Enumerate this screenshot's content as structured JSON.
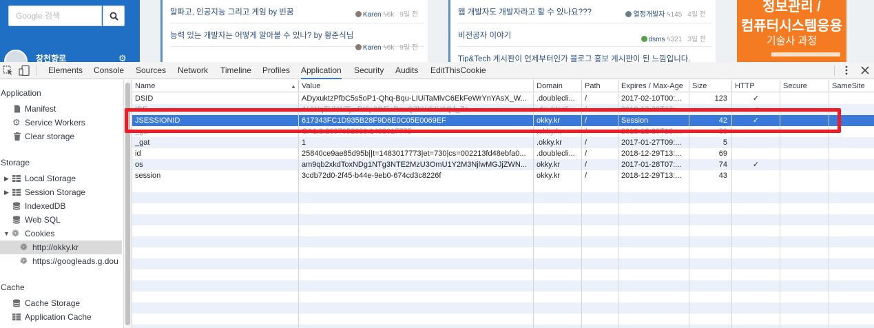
{
  "page": {
    "search": {
      "placeholder": "Google 검색"
    },
    "nav_user": "창천향로",
    "posts_left": [
      {
        "title": "알파고, 인공지능 그리고 게임 by 빈꿈",
        "author": "Karen",
        "score": "6k",
        "ago": "9일 전"
      },
      {
        "title": "능력 있는 개발자는 어떻게 알아볼 수 있나? by 황준식님",
        "author": "Karen",
        "score": "6k",
        "ago": "9일 전"
      }
    ],
    "posts_right": [
      {
        "title": "웹 개발자도 개발자라고 할 수 있나요???",
        "author": "열정개발자",
        "score": "145",
        "ago": "4일 전"
      },
      {
        "title": "비전공자 이야기",
        "author": "dsms",
        "score": "321",
        "ago": "3일 전"
      },
      {
        "title": "Tip&Tech 게시판이 언제부터인가 블로그 홍보 게시판이 된 느낌입니다.",
        "author": "",
        "score": "",
        "ago": ""
      }
    ],
    "ad": {
      "line1": "정보관리 /",
      "line2": "컴퓨터시스템응용",
      "line3": "기술사 과정"
    }
  },
  "devtools": {
    "tabs": [
      "Elements",
      "Console",
      "Sources",
      "Network",
      "Timeline",
      "Profiles",
      "Application",
      "Security",
      "Audits",
      "EditThisCookie"
    ],
    "active_tab": "Application",
    "accent": "#3879d9"
  },
  "sidebar": {
    "application_heading": "Application",
    "application_items": [
      "Manifest",
      "Service Workers",
      "Clear storage"
    ],
    "storage_heading": "Storage",
    "storage_items": [
      "Local Storage",
      "Session Storage",
      "IndexedDB",
      "Web SQL",
      "Cookies"
    ],
    "cookie_origins": [
      "http://okky.kr",
      "https://googleads.g.dou"
    ],
    "cache_heading": "Cache",
    "cache_items": [
      "Cache Storage",
      "Application Cache"
    ]
  },
  "grid": {
    "columns": [
      "Name",
      "Value",
      "Domain",
      "Path",
      "Expires / Max-Age",
      "Size",
      "HTTP",
      "Secure",
      "SameSite"
    ],
    "rows": [
      {
        "name": "DSID",
        "value": "ADyxuktzPfbC5s5oP1-Qhq-Bqu-LIUiTaMlvC6EkFeWrYnYAsX_W...",
        "domain": ".doublecli...",
        "path": "/",
        "expires": "2017-02-10T00:...",
        "size": "123",
        "http": "✓",
        "secure": "",
        "samesite": ""
      },
      {
        "name": "IDE",
        "value": "AHWqTUkWZj...Rt3p3Gf5cPmrQ7hYdUH6QJ_Ze...",
        "domain": ".doublecli...",
        "path": "/",
        "expires": "2018-12-29T13:...",
        "size": "",
        "http": "✓",
        "secure": "",
        "samesite": ""
      },
      {
        "name": "JSESSIONID",
        "value": "617343FC1D935B28F9D6E0C05E0069EF",
        "domain": "okky.kr",
        "path": "/",
        "expires": "Session",
        "size": "42",
        "http": "✓",
        "secure": "",
        "samesite": ""
      },
      {
        "name": "_ga",
        "value": "GA1.2.2097052033.1483017775",
        "domain": ".okky.kr",
        "path": "/",
        "expires": "2018-12-29T13:...",
        "size": "30",
        "http": "",
        "secure": "",
        "samesite": ""
      },
      {
        "name": "_gat",
        "value": "1",
        "domain": ".okky.kr",
        "path": "/",
        "expires": "2017-01-27T09:...",
        "size": "5",
        "http": "",
        "secure": "",
        "samesite": ""
      },
      {
        "name": "id",
        "value": "25840ce9ae85d95b||t=1483017773|et=730|cs=002213fd48ebfa0...",
        "domain": ".doublecli...",
        "path": "/",
        "expires": "2018-12-29T13:...",
        "size": "69",
        "http": "",
        "secure": "",
        "samesite": ""
      },
      {
        "name": "os",
        "value": "am9qb2xkdToxNDg1NTg3NTE2MzU3OmU1Y2M3NjlwMGJjZWN...",
        "domain": "okky.kr",
        "path": "/",
        "expires": "2017-01-28T07:...",
        "size": "74",
        "http": "✓",
        "secure": "",
        "samesite": ""
      },
      {
        "name": "session",
        "value": "3cdb72d0-2f45-b44e-9eb0-674cd3c8226f",
        "domain": "okky.kr",
        "path": "/",
        "expires": "2018-12-29T13:...",
        "size": "43",
        "http": "",
        "secure": "",
        "samesite": ""
      }
    ],
    "selected_row_color": "#3879d9",
    "highlight_color": "#ee1c24"
  }
}
